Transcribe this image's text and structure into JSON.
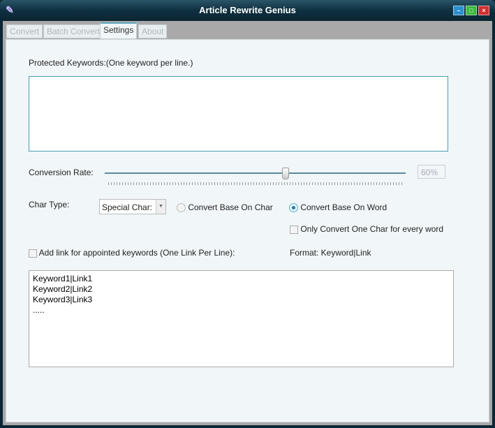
{
  "window": {
    "title": "Article Rewrite Genius"
  },
  "tabs": [
    {
      "label": "Convert"
    },
    {
      "label": "Batch Convert"
    },
    {
      "label": "Settings"
    },
    {
      "label": "About"
    }
  ],
  "settings": {
    "protected_label": "Protected Keywords:(One keyword per line.)",
    "protected_value": "",
    "rate_label": "Conversion Rate:",
    "rate_value": "60%",
    "rate_percent": 60,
    "char_type_label": "Char Type:",
    "char_type_value": "Special Char:",
    "radio_char": "Convert Base On Char",
    "radio_word": "Convert Base On Word",
    "only_one_char": "Only Convert One Char for every word",
    "add_link_label": "Add link for appointed keywords (One Link Per Line):",
    "format_label": "Format: Keyword|Link",
    "links_value": "Keyword1|Link1\nKeyword2|Link2\nKeyword3|Link3\n....."
  }
}
